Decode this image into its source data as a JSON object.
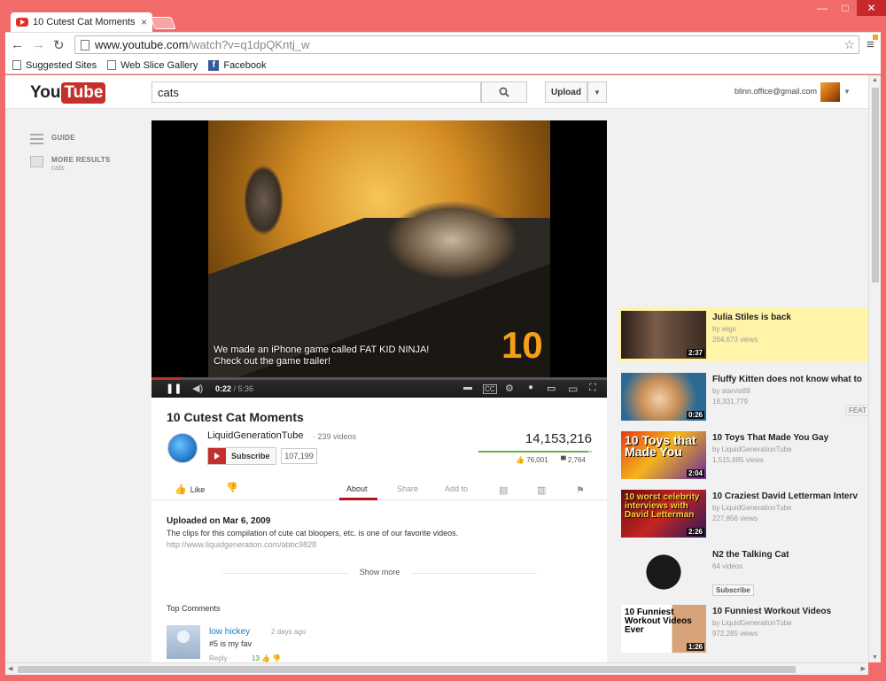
{
  "browser": {
    "tab_title": "10 Cutest Cat Moments -",
    "tab_close": "×",
    "url_host": "www.youtube.com",
    "url_path": "/watch?v=q1dpQKntj_w",
    "bookmarks": [
      {
        "label": "Suggested Sites"
      },
      {
        "label": "Web Slice Gallery"
      },
      {
        "label": "Facebook"
      }
    ],
    "win_min": "—",
    "win_max": "□",
    "win_close": "✕"
  },
  "masthead": {
    "logo_you": "You",
    "logo_tube": "Tube",
    "search_value": "cats",
    "upload_label": "Upload",
    "email": "blinn.office@gmail.com"
  },
  "guide": {
    "items": [
      {
        "label": "GUIDE",
        "sub": ""
      },
      {
        "label": "MORE RESULTS",
        "sub": "cats"
      }
    ]
  },
  "player": {
    "caption_line1": "We made an iPhone game called FAT KID NINJA!",
    "caption_line2": "Check out the game trailer!",
    "overlay_number": "10",
    "time_current": "0:22",
    "time_total": "/ 5:36",
    "progress": 0.065
  },
  "video": {
    "title": "10 Cutest Cat Moments",
    "channel": "LiquidGenerationTube",
    "channel_videos": "· 239 videos",
    "subscribe_label": "Subscribe",
    "subscribers": "107,199",
    "views": "14,153,216",
    "likes": "76,001",
    "dislikes": "2,764",
    "like_label": "Like",
    "tabs": [
      "About",
      "Share",
      "Add to"
    ],
    "uploaded": "Uploaded on Mar 6, 2009",
    "description": "The clips for this compilation of cute cat bloopers, etc. is one of our favorite videos.",
    "link": "http://www.liquidgeneration.com/abbc9828",
    "show_more": "Show more"
  },
  "comments": {
    "header": "Top Comments",
    "items": [
      {
        "author": "low hickey",
        "time": "2 days ago",
        "text": "#5 is my fav",
        "reply": "Reply ·",
        "votes": "13"
      }
    ]
  },
  "related": [
    {
      "title": "Julia Stiles is back",
      "by": "by wigs",
      "views": "264,673 views",
      "duration": "2:37",
      "highlight": true
    },
    {
      "title": "Fluffy Kitten does not know what to",
      "by": "by starvis89",
      "views": "18,331,779",
      "duration": "0:26",
      "badge": "FEAT"
    },
    {
      "title": "10 Toys That Made You Gay",
      "by": "by LiquidGenerationTube",
      "views": "1,515,685 views",
      "duration": "2:04",
      "thumb_text": "10 Toys that Made You"
    },
    {
      "title": "10 Craziest David Letterman Interv",
      "by": "by LiquidGenerationTube",
      "views": "227,856 views",
      "duration": "2:26",
      "thumb_text": "10 worst celebrity interviews with David Letterman"
    },
    {
      "title": "N2 the Talking Cat",
      "by": "64 videos",
      "views": "",
      "subscribe": "Subscribe"
    },
    {
      "title": "10 Funniest Workout Videos",
      "by": "by LiquidGenerationTube",
      "views": "972,285 views",
      "duration": "1:26",
      "thumb_text": "10 Funniest Workout Videos Ever"
    }
  ]
}
